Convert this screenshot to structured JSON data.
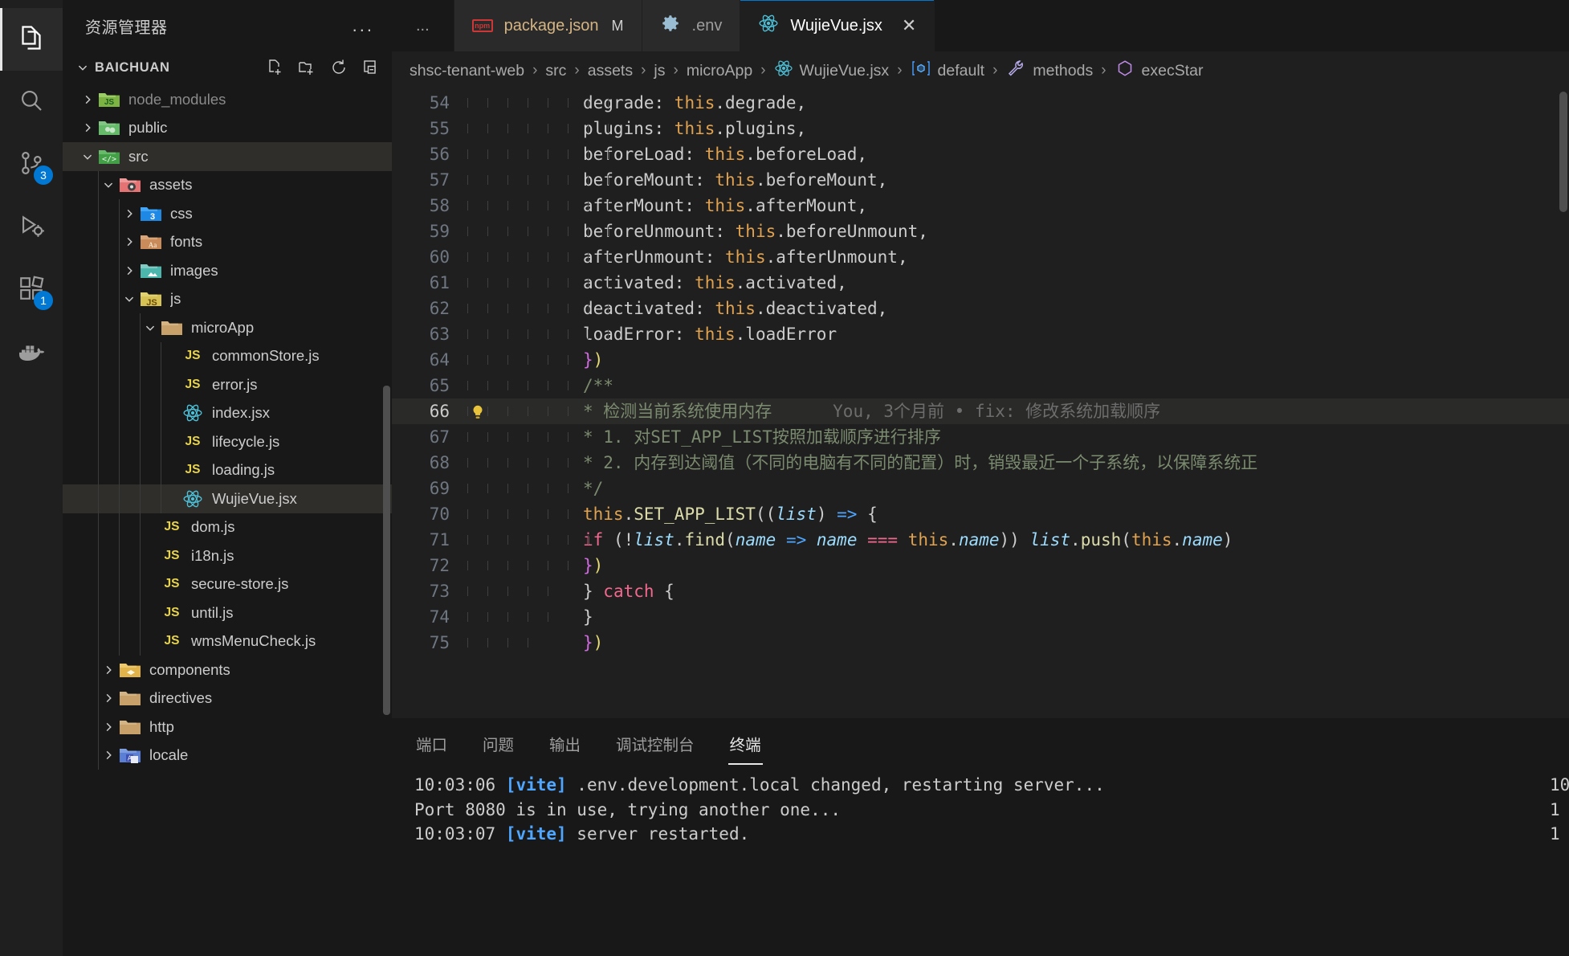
{
  "activitybar": {
    "items": [
      {
        "name": "explorer",
        "icon": "files-icon",
        "badge": null,
        "active": true
      },
      {
        "name": "search",
        "icon": "search-icon",
        "badge": null,
        "active": false
      },
      {
        "name": "source-control",
        "icon": "source-control-icon",
        "badge": "3",
        "active": false
      },
      {
        "name": "run-and-debug",
        "icon": "run-debug-icon",
        "badge": null,
        "active": false
      },
      {
        "name": "extensions",
        "icon": "extensions-icon",
        "badge": "1",
        "active": false
      },
      {
        "name": "docker",
        "icon": "docker-icon",
        "badge": null,
        "active": false
      }
    ]
  },
  "sidebar": {
    "title": "资源管理器",
    "more_label": "...",
    "section": {
      "name": "BAICHUAN",
      "actions": [
        {
          "name": "new-file",
          "icon": "new-file-icon"
        },
        {
          "name": "new-folder",
          "icon": "new-folder-icon"
        },
        {
          "name": "refresh-explorer",
          "icon": "refresh-icon"
        },
        {
          "name": "collapse-folders",
          "icon": "collapse-all-icon"
        }
      ]
    },
    "tree": [
      {
        "label": "node_modules",
        "type": "folder",
        "icon": "folder-node-icon",
        "indent": 1,
        "expanded": false,
        "dim": true,
        "selected": false
      },
      {
        "label": "public",
        "type": "folder",
        "icon": "folder-public-icon",
        "indent": 1,
        "expanded": false,
        "dim": false,
        "selected": false
      },
      {
        "label": "src",
        "type": "folder",
        "icon": "folder-src-icon",
        "indent": 1,
        "expanded": true,
        "dim": false,
        "selected": true
      },
      {
        "label": "assets",
        "type": "folder",
        "icon": "folder-assets-icon",
        "indent": 2,
        "expanded": true,
        "dim": false,
        "selected": false
      },
      {
        "label": "css",
        "type": "folder",
        "icon": "folder-css-icon",
        "indent": 3,
        "expanded": false,
        "dim": false,
        "selected": false
      },
      {
        "label": "fonts",
        "type": "folder",
        "icon": "folder-fonts-icon",
        "indent": 3,
        "expanded": false,
        "dim": false,
        "selected": false
      },
      {
        "label": "images",
        "type": "folder",
        "icon": "folder-images-icon",
        "indent": 3,
        "expanded": false,
        "dim": false,
        "selected": false
      },
      {
        "label": "js",
        "type": "folder",
        "icon": "folder-js-icon",
        "indent": 3,
        "expanded": true,
        "dim": false,
        "selected": false
      },
      {
        "label": "microApp",
        "type": "folder",
        "icon": "folder-icon",
        "indent": 4,
        "expanded": true,
        "dim": false,
        "selected": false
      },
      {
        "label": "commonStore.js",
        "type": "file",
        "icon": "js-file-icon",
        "indent": 5,
        "expanded": null,
        "dim": false,
        "selected": false
      },
      {
        "label": "error.js",
        "type": "file",
        "icon": "js-file-icon",
        "indent": 5,
        "expanded": null,
        "dim": false,
        "selected": false
      },
      {
        "label": "index.jsx",
        "type": "file",
        "icon": "react-file-icon",
        "indent": 5,
        "expanded": null,
        "dim": false,
        "selected": false
      },
      {
        "label": "lifecycle.js",
        "type": "file",
        "icon": "js-file-icon",
        "indent": 5,
        "expanded": null,
        "dim": false,
        "selected": false
      },
      {
        "label": "loading.js",
        "type": "file",
        "icon": "js-file-icon",
        "indent": 5,
        "expanded": null,
        "dim": false,
        "selected": false
      },
      {
        "label": "WujieVue.jsx",
        "type": "file",
        "icon": "react-file-icon",
        "indent": 5,
        "expanded": null,
        "dim": false,
        "selected": true
      },
      {
        "label": "dom.js",
        "type": "file",
        "icon": "js-file-icon",
        "indent": 4,
        "expanded": null,
        "dim": false,
        "selected": false
      },
      {
        "label": "i18n.js",
        "type": "file",
        "icon": "js-file-icon",
        "indent": 4,
        "expanded": null,
        "dim": false,
        "selected": false
      },
      {
        "label": "secure-store.js",
        "type": "file",
        "icon": "js-file-icon",
        "indent": 4,
        "expanded": null,
        "dim": false,
        "selected": false
      },
      {
        "label": "until.js",
        "type": "file",
        "icon": "js-file-icon",
        "indent": 4,
        "expanded": null,
        "dim": false,
        "selected": false
      },
      {
        "label": "wmsMenuCheck.js",
        "type": "file",
        "icon": "js-file-icon",
        "indent": 4,
        "expanded": null,
        "dim": false,
        "selected": false
      },
      {
        "label": "components",
        "type": "folder",
        "icon": "folder-components-icon",
        "indent": 2,
        "expanded": false,
        "dim": false,
        "selected": false
      },
      {
        "label": "directives",
        "type": "folder",
        "icon": "folder-icon",
        "indent": 2,
        "expanded": false,
        "dim": false,
        "selected": false
      },
      {
        "label": "http",
        "type": "folder",
        "icon": "folder-icon",
        "indent": 2,
        "expanded": false,
        "dim": false,
        "selected": false
      },
      {
        "label": "locale",
        "type": "folder",
        "icon": "folder-locale-icon",
        "indent": 2,
        "expanded": false,
        "dim": false,
        "selected": false
      }
    ]
  },
  "tabs": {
    "overflow_label": "...",
    "items": [
      {
        "label": "package.json",
        "icon": "npm-icon",
        "badge": "M",
        "active": false,
        "closable": false
      },
      {
        "label": ".env",
        "icon": "gear-icon",
        "badge": "",
        "active": false,
        "closable": false
      },
      {
        "label": "WujieVue.jsx",
        "icon": "react-icon",
        "badge": "",
        "active": true,
        "closable": true
      }
    ],
    "close_glyph": "✕"
  },
  "breadcrumb": {
    "separator": "›",
    "items": [
      {
        "label": "shsc-tenant-web",
        "icon": null
      },
      {
        "label": "src",
        "icon": null
      },
      {
        "label": "assets",
        "icon": null
      },
      {
        "label": "js",
        "icon": null
      },
      {
        "label": "microApp",
        "icon": null
      },
      {
        "label": "WujieVue.jsx",
        "icon": "react-icon"
      },
      {
        "label": "default",
        "icon": "symbol-object-icon"
      },
      {
        "label": "methods",
        "icon": "symbol-method-icon"
      },
      {
        "label": "execStar",
        "icon": "symbol-field-icon"
      }
    ]
  },
  "editor": {
    "git_blame": "You, 3个月前 • fix: 修改系统加载顺序",
    "lines": [
      {
        "no": "54",
        "text": "degrade: this.degrade,"
      },
      {
        "no": "55",
        "text": "plugins: this.plugins,"
      },
      {
        "no": "56",
        "text": "beforeLoad: this.beforeLoad,"
      },
      {
        "no": "57",
        "text": "beforeMount: this.beforeMount,"
      },
      {
        "no": "58",
        "text": "afterMount: this.afterMount,"
      },
      {
        "no": "59",
        "text": "beforeUnmount: this.beforeUnmount,"
      },
      {
        "no": "60",
        "text": "afterUnmount: this.afterUnmount,"
      },
      {
        "no": "61",
        "text": "activated: this.activated,"
      },
      {
        "no": "62",
        "text": "deactivated: this.deactivated,"
      },
      {
        "no": "63",
        "text": "loadError: this.loadError"
      },
      {
        "no": "64",
        "text": "})"
      },
      {
        "no": "65",
        "text": "/**"
      },
      {
        "no": "66",
        "text": "* 检测当前系统使用内存"
      },
      {
        "no": "67",
        "text": "* 1. 对SET_APP_LIST按照加载顺序进行排序"
      },
      {
        "no": "68",
        "text": "* 2. 内存到达阈值（不同的电脑有不同的配置）时，销毁最近一个子系统，以保障系统正"
      },
      {
        "no": "69",
        "text": "*/"
      },
      {
        "no": "70",
        "text": "this.SET_APP_LIST((list) => {"
      },
      {
        "no": "71",
        "text": "if (!list.find(name => name === this.name)) list.push(this.name)"
      },
      {
        "no": "72",
        "text": "})"
      },
      {
        "no": "73",
        "text": "} catch {"
      },
      {
        "no": "74",
        "text": "}"
      },
      {
        "no": "75",
        "text": "})"
      }
    ]
  },
  "panel": {
    "tabs": [
      {
        "label": "端口",
        "active": false
      },
      {
        "label": "问题",
        "active": false
      },
      {
        "label": "输出",
        "active": false
      },
      {
        "label": "调试控制台",
        "active": false
      },
      {
        "label": "终端",
        "active": true
      }
    ],
    "terminal": [
      {
        "time": "10:03:06",
        "tag": "[vite]",
        "msg": " .env.development.local changed, restarting server...",
        "right": "10"
      },
      {
        "time": "",
        "tag": "",
        "msg": "Port 8080 is in use, trying another one...",
        "right": "1"
      },
      {
        "time": "10:03:07",
        "tag": "[vite]",
        "msg": " server restarted.",
        "right": "1"
      }
    ]
  },
  "colors": {
    "accent": "#0078d4",
    "background": "#1f1f1f",
    "sidebar_bg": "#181818",
    "badge": "#0078d4",
    "selected_row": "#2f2e2b",
    "comment": "#7b8b6f",
    "this_keyword": "#e0a24f"
  }
}
